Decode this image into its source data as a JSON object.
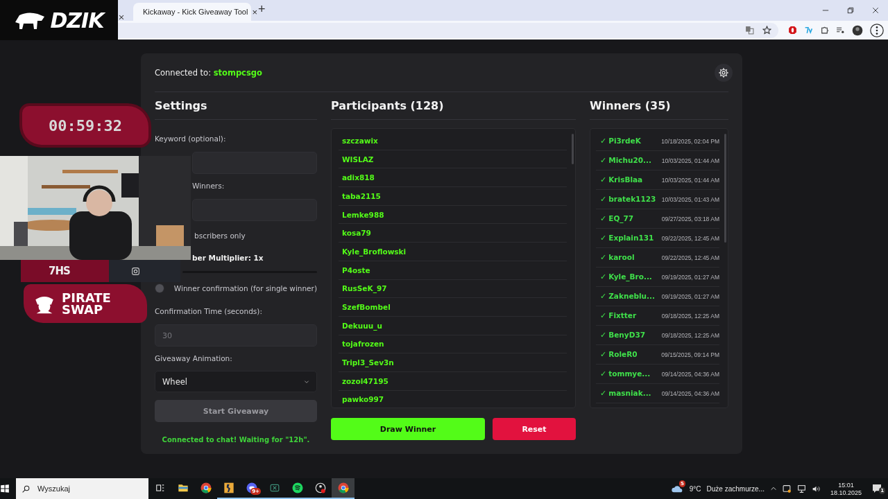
{
  "browser": {
    "tabs": [
      {
        "title": "Kickaway - Kick Giveaway Tool",
        "selected": true,
        "close": "×"
      }
    ],
    "new_tab": "+"
  },
  "stream_overlay": {
    "logo": "DZIK",
    "timer": "00:59:32",
    "social_logo": "7HS",
    "sponsor": "PIRATE SWAP"
  },
  "app": {
    "connected_label": "Connected to:",
    "channel": "stompcsgo",
    "settings": {
      "title": "Settings",
      "keyword_label": "Keyword (optional):",
      "winners_label": "Winners:",
      "subscribers_label": "bscribers only",
      "multiplier_label": "ber Multiplier: 1x",
      "confirmation": {
        "label": "Winner confirmation (for single winner)",
        "on": false
      },
      "confirmation_time_label": "Confirmation Time (seconds):",
      "confirmation_time": {
        "placeholder": "30"
      },
      "animation_label": "Giveaway Animation:",
      "animation": {
        "value": "Wheel"
      },
      "start_button": {
        "label": "Start Giveaway",
        "disabled": true
      },
      "status": "Connected to chat! Waiting for \"12h\"."
    },
    "participants": {
      "title": "Participants (128)",
      "items": [
        "szczawix",
        "WISLAZ",
        "adix818",
        "taba2115",
        "Lemke988",
        "kosa79",
        "Kyle_Broflowski",
        "P4oste",
        "RusSeK_97",
        "SzefBombel",
        "Dekuuu_u",
        "tojafrozen",
        "Tripl3_Sev3n",
        "zozol47195",
        "pawko997"
      ]
    },
    "draw_button": "Draw Winner",
    "reset_button": "Reset",
    "winners": {
      "title": "Winners (35)",
      "items": [
        {
          "check": "✓",
          "name": "Pi3rdeK",
          "time": "10/18/2025, 02:04 PM"
        },
        {
          "check": "✓",
          "name": "Michu20...",
          "time": "10/03/2025, 01:44 AM"
        },
        {
          "check": "✓",
          "name": "KrisBlaa",
          "time": "10/03/2025, 01:44 AM"
        },
        {
          "check": "✓",
          "name": "bratek1123",
          "time": "10/03/2025, 01:43 AM"
        },
        {
          "check": "✓",
          "name": "EQ_77",
          "time": "09/27/2025, 03:18 AM"
        },
        {
          "check": "✓",
          "name": "Explain131",
          "time": "09/22/2025, 12:45 AM"
        },
        {
          "check": "✓",
          "name": "karool",
          "time": "09/22/2025, 12:45 AM"
        },
        {
          "check": "✓",
          "name": "Kyle_Bro...",
          "time": "09/19/2025, 01:27 AM"
        },
        {
          "check": "✓",
          "name": "Zakneblu...",
          "time": "09/19/2025, 01:27 AM"
        },
        {
          "check": "✓",
          "name": "Fixtter",
          "time": "09/18/2025, 12:25 AM"
        },
        {
          "check": "✓",
          "name": "BenyD37",
          "time": "09/18/2025, 12:25 AM"
        },
        {
          "check": "✓",
          "name": "RoleR0",
          "time": "09/15/2025, 09:14 PM"
        },
        {
          "check": "✓",
          "name": "tommye...",
          "time": "09/14/2025, 04:36 AM"
        },
        {
          "check": "✓",
          "name": "masniak...",
          "time": "09/14/2025, 04:36 AM"
        }
      ]
    }
  },
  "taskbar": {
    "search": {
      "placeholder": "Wyszukaj"
    },
    "apps": [
      {
        "kind": "folder",
        "running": false,
        "selected": false
      },
      {
        "kind": "chrome",
        "running": false,
        "selected": false
      },
      {
        "kind": "game",
        "running": true,
        "selected": false
      },
      {
        "kind": "chat",
        "running": true,
        "selected": false,
        "badge": "9+"
      },
      {
        "kind": "xbox",
        "running": true,
        "selected": false
      },
      {
        "kind": "music",
        "running": true,
        "selected": false
      },
      {
        "kind": "record",
        "running": true,
        "selected": false
      },
      {
        "kind": "chrome",
        "running": true,
        "selected": true
      }
    ],
    "weather": {
      "badge": "5",
      "temperature": "9°C",
      "condition": "Duże zachmurze..."
    },
    "time": "15:01",
    "date": "18.10.2025",
    "notifications": "1"
  }
}
